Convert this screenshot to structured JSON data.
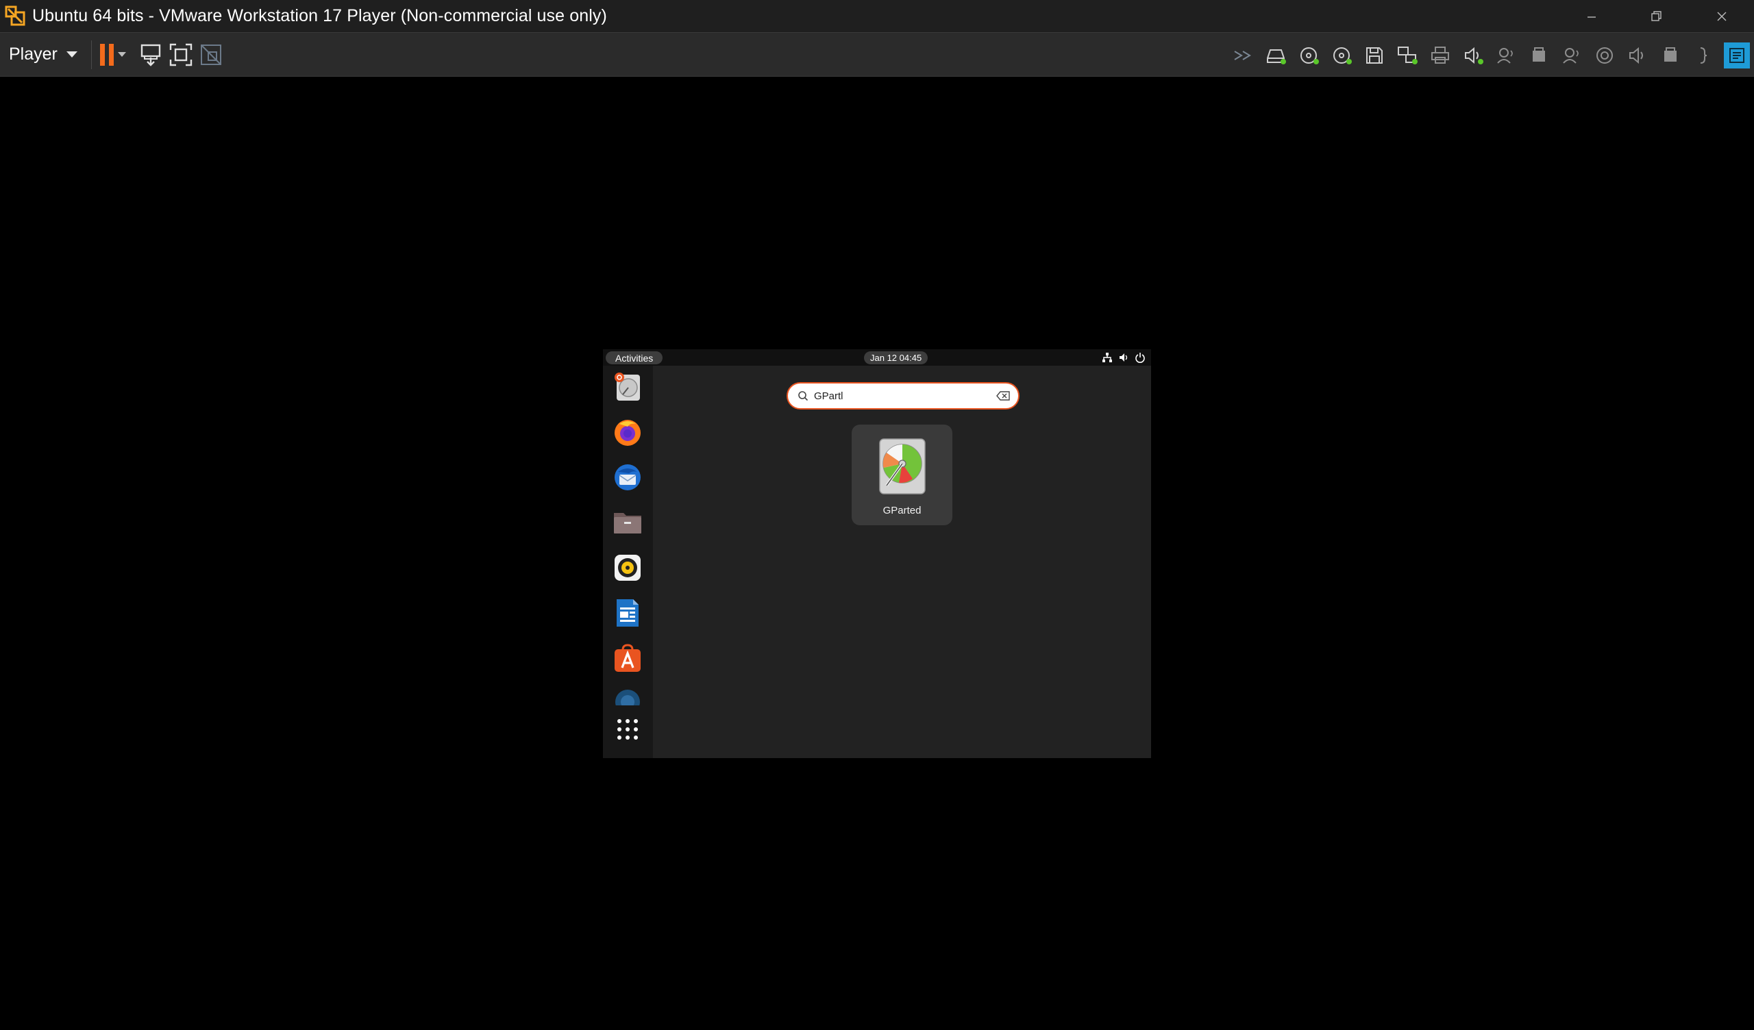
{
  "window": {
    "title": "Ubuntu 64 bits - VMware Workstation 17 Player (Non-commercial use only)"
  },
  "toolbar": {
    "player_label": "Player"
  },
  "guest": {
    "topbar": {
      "activities_label": "Activities",
      "clock": "Jan 12  04:45"
    },
    "search": {
      "value": "GPartl"
    },
    "results": [
      {
        "label": "GParted",
        "icon": "gparted-icon"
      }
    ],
    "dock_items": [
      "gparted-installer-icon",
      "firefox-icon",
      "thunderbird-icon",
      "files-icon",
      "rhythmbox-icon",
      "libreoffice-writer-icon",
      "app-center-icon",
      "show-apps-icon"
    ]
  },
  "colors": {
    "accent": "#e95420",
    "pause": "#f36b1c",
    "device_connected": "#5ac72a"
  }
}
